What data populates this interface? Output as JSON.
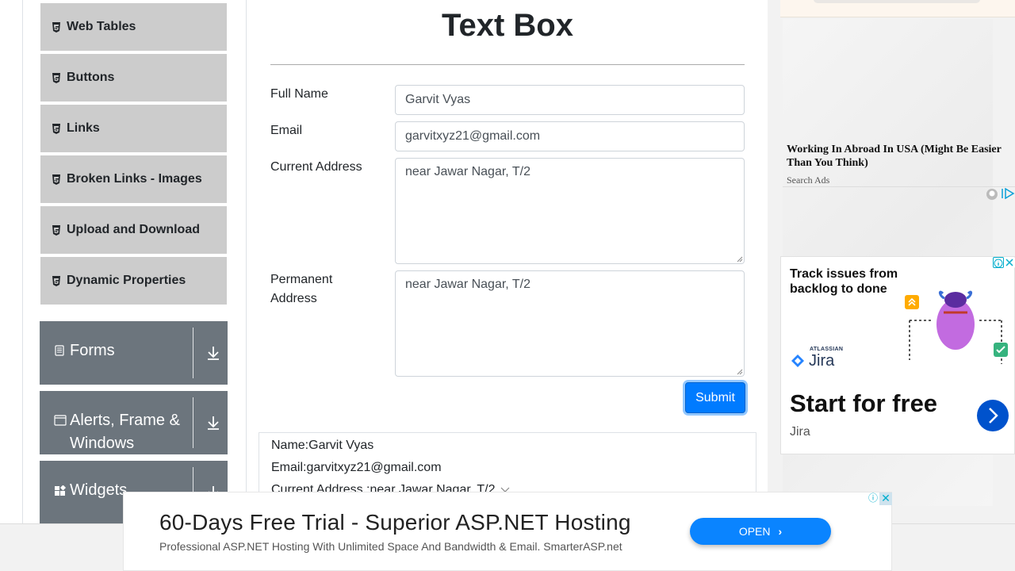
{
  "sidebar": {
    "sub_items": [
      "Web Tables",
      "Buttons",
      "Links",
      "Broken Links - Images",
      "Upload and Download",
      "Dynamic Properties"
    ],
    "groups": [
      {
        "label": "Forms",
        "icon": "document-icon"
      },
      {
        "label": "Alerts, Frame & Windows",
        "icon": "window-icon"
      },
      {
        "label": "Widgets",
        "icon": "widgets-icon"
      }
    ]
  },
  "main": {
    "title": "Text Box",
    "fields": {
      "full_name": {
        "label": "Full Name",
        "value": "Garvit Vyas"
      },
      "email": {
        "label": "Email",
        "value": "garvitxyz21@gmail.com"
      },
      "current_address": {
        "label": "Current Address",
        "value": "near Jawar Nagar, T/2"
      },
      "permanent_address": {
        "label": "Permanent Address",
        "value": "near Jawar Nagar, T/2"
      }
    },
    "submit_label": "Submit",
    "output": {
      "name": "Name:Garvit Vyas",
      "email": "Email:garvitxyz21@gmail.com",
      "current_address": "Current Address :near Jawar Nagar, T/2"
    }
  },
  "ads": {
    "side_text": {
      "headline": "Working In Abroad In USA (Might Be Easier Than You Think)",
      "source": "Search Ads"
    },
    "jira": {
      "headline": "Track issues from backlog to done",
      "company": "ATLASSIAN",
      "brand": "Jira",
      "cta": "Start for free",
      "sub": "Jira"
    },
    "bottom": {
      "headline": "60-Days Free Trial - Superior ASP.NET Hosting",
      "sub": "Professional ASP.NET Hosting With Unlimited Space And Bandwidth & Email. SmarterASP.net",
      "button": "OPEN"
    }
  },
  "colors": {
    "primary": "#007bff",
    "sidebar_group": "#6c757d",
    "sidebar_item": "#cccccc",
    "jira_blue": "#0052cc"
  }
}
